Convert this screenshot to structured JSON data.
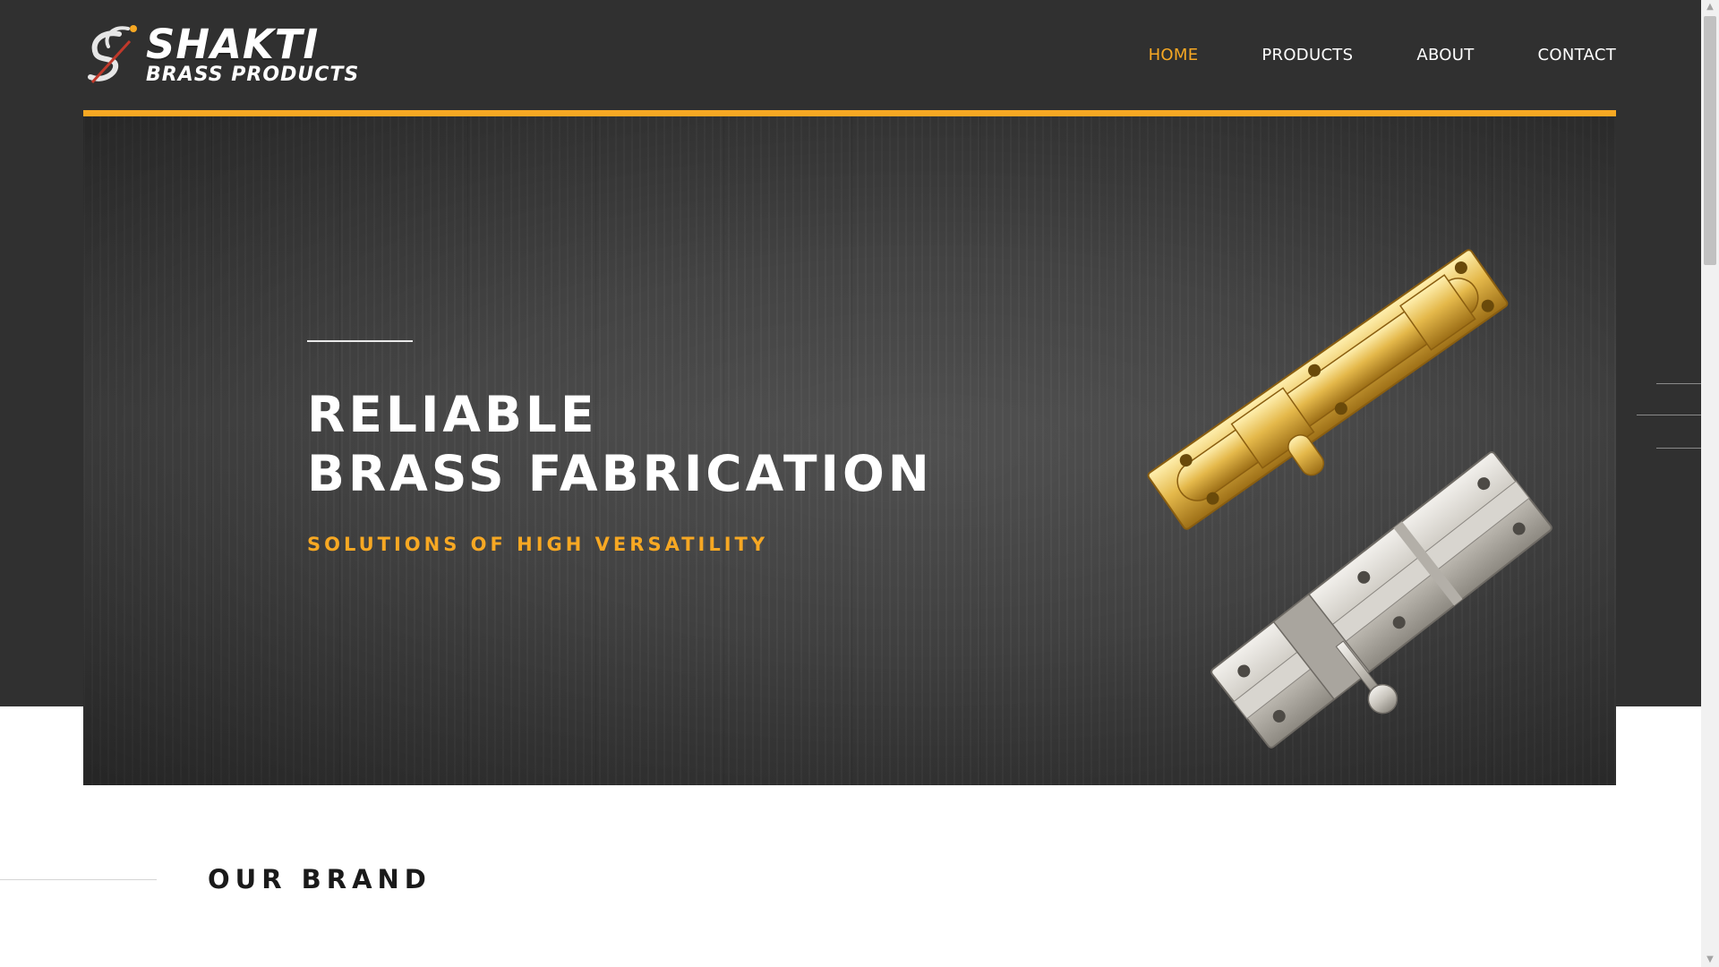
{
  "brand": {
    "name": "SHAKTI",
    "tagline": "BRASS PRODUCTS"
  },
  "nav": {
    "items": [
      {
        "label": "HOME",
        "active": true
      },
      {
        "label": "PRODUCTS",
        "active": false
      },
      {
        "label": "ABOUT",
        "active": false
      },
      {
        "label": "CONTACT",
        "active": false
      }
    ]
  },
  "hero": {
    "title_line1": "RELIABLE",
    "title_line2": "BRASS FABRICATION",
    "subtitle": "SOLUTIONS OF HIGH VERSATILITY",
    "product_image": "brass-tower-bolts"
  },
  "brand_section": {
    "title": "OUR BRAND"
  },
  "colors": {
    "accent": "#f7a823",
    "header_bg": "#303030",
    "text_light": "#ffffff",
    "text_dark": "#1a1a1a"
  },
  "icons": {
    "logo_mark": "sb-monogram-icon",
    "scroll_up": "arrow-up-icon",
    "scroll_down": "arrow-down-icon"
  }
}
